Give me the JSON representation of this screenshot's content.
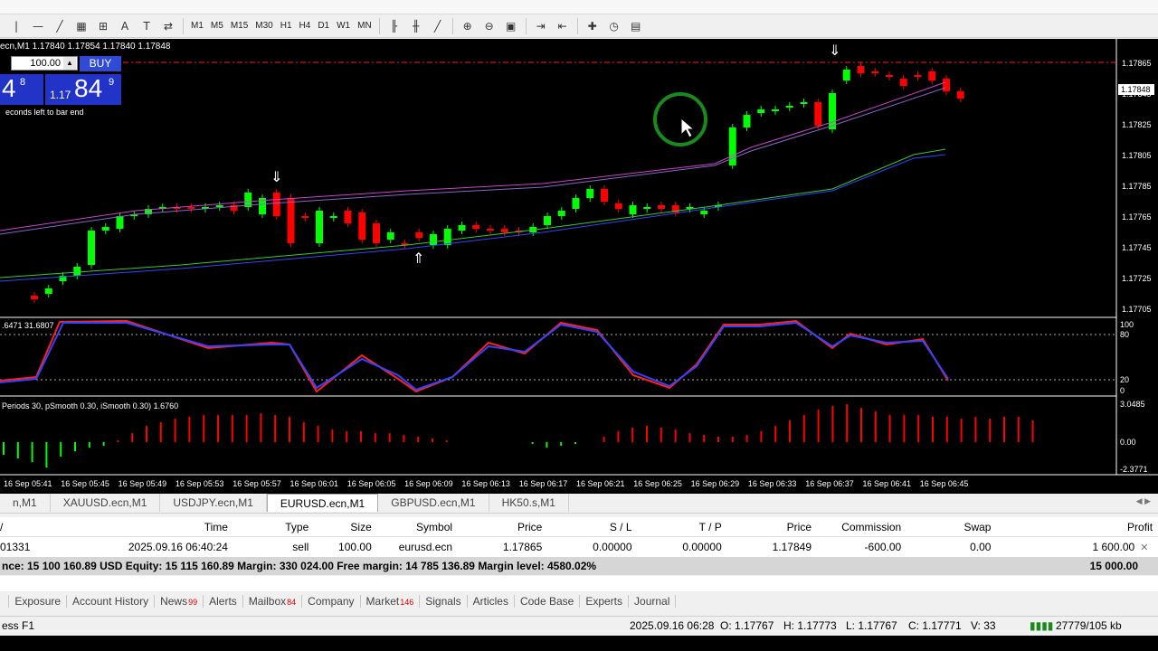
{
  "toolbar": {
    "timeframes": [
      "M1",
      "M5",
      "M15",
      "M30",
      "H1",
      "H4",
      "D1",
      "W1",
      "MN"
    ]
  },
  "chart": {
    "ticker": "ecn,M1  1.17840 1.17854 1.17840 1.17848",
    "oneclick": {
      "lot": "100.00",
      "buy_label": "BUY",
      "sell_big": "4",
      "sell_sup": "8",
      "buy_small": "1.17",
      "buy_big": "84",
      "buy_sup": "9",
      "bar_end": "econds left to bar end"
    },
    "price_labels": [
      "1.17865",
      "1.17845",
      "1.17825",
      "1.17805",
      "1.17785",
      "1.17765",
      "1.17745",
      "1.17725",
      "1.17705"
    ],
    "current_price": "1.17848",
    "stoch_label": ".6471 31.6807",
    "stoch_levels": [
      "100",
      "80",
      "20",
      "0"
    ],
    "ind2_label": "Periods 30, pSmooth 0.30, iSmooth 0.30)  1.6760",
    "ind2_levels": [
      "3.0485",
      "0.00",
      "-2.3771"
    ],
    "time_labels": [
      "16 Sep 05:41",
      "16 Sep 05:45",
      "16 Sep 05:49",
      "16 Sep 05:53",
      "16 Sep 05:57",
      "16 Sep 06:01",
      "16 Sep 06:05",
      "16 Sep 06:09",
      "16 Sep 06:13",
      "16 Sep 06:17",
      "16 Sep 06:21",
      "16 Sep 06:25",
      "16 Sep 06:29",
      "16 Sep 06:33",
      "16 Sep 06:37",
      "16 Sep 06:41",
      "16 Sep 06:45"
    ]
  },
  "symbol_tabs": [
    "n,M1",
    "XAUUSD.ecn,M1",
    "USDJPY.ecn,M1",
    "EURUSD.ecn,M1",
    "GBPUSD.ecn,M1",
    "HK50.s,M1"
  ],
  "active_tab": "EURUSD.ecn,M1",
  "trade": {
    "headers": [
      "/",
      "Time",
      "Type",
      "Size",
      "Symbol",
      "Price",
      "S / L",
      "T / P",
      "Price",
      "Commission",
      "Swap",
      "Profit"
    ],
    "row": [
      "01331",
      "2025.09.16 06:40:24",
      "sell",
      "100.00",
      "eurusd.ecn",
      "1.17865",
      "0.00000",
      "0.00000",
      "1.17849",
      "-600.00",
      "0.00",
      "1 600.00"
    ],
    "summary": "nce: 15 100 160.89 USD  Equity: 15 115 160.89  Margin: 330 024.00  Free margin: 14 785 136.89  Margin level: 4580.02%",
    "summary_profit": "15 000.00"
  },
  "bottom_tabs": [
    {
      "label": "Exposure",
      "badge": ""
    },
    {
      "label": "Account History",
      "badge": ""
    },
    {
      "label": "News",
      "badge": "99"
    },
    {
      "label": "Alerts",
      "badge": ""
    },
    {
      "label": "Mailbox",
      "badge": "84"
    },
    {
      "label": "Company",
      "badge": ""
    },
    {
      "label": "Market",
      "badge": "146"
    },
    {
      "label": "Signals",
      "badge": ""
    },
    {
      "label": "Articles",
      "badge": ""
    },
    {
      "label": "Code Base",
      "badge": ""
    },
    {
      "label": "Experts",
      "badge": ""
    },
    {
      "label": "Journal",
      "badge": ""
    }
  ],
  "status": {
    "help": "ess F1",
    "datetime": "2025.09.16 06:28",
    "open": "O: 1.17767",
    "high": "H: 1.17773",
    "low": "L: 1.17767",
    "close": "C: 1.17771",
    "volume": "V: 33",
    "traffic": "27779/105 kb"
  },
  "colors": {
    "bull": "#00ff00",
    "bear": "#ff0000",
    "ma_violet": "#cc44cc",
    "ma_green": "#33cc33",
    "ma_blue": "#3344ff"
  }
}
